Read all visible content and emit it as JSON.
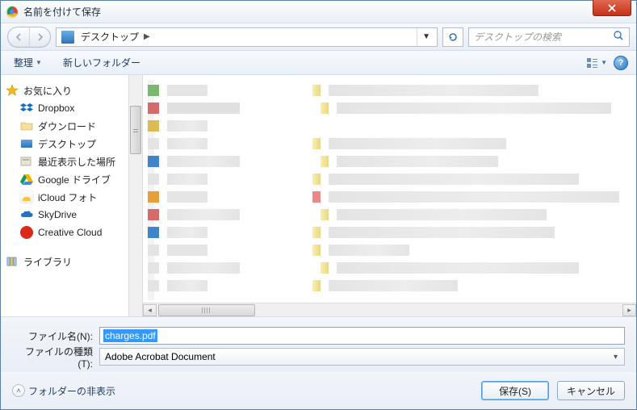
{
  "window": {
    "title": "名前を付けて保存"
  },
  "nav": {
    "location": "デスクトップ",
    "search_placeholder": "デスクトップの検索"
  },
  "toolbar": {
    "organize": "整理",
    "new_folder": "新しいフォルダー"
  },
  "sidebar": {
    "favorites_label": "お気に入り",
    "items": [
      {
        "label": "Dropbox"
      },
      {
        "label": "ダウンロード"
      },
      {
        "label": "デスクトップ"
      },
      {
        "label": "最近表示した場所"
      },
      {
        "label": "Google ドライブ"
      },
      {
        "label": "iCloud フォト"
      },
      {
        "label": "SkyDrive"
      },
      {
        "label": "Creative Cloud"
      }
    ],
    "libraries_label": "ライブラリ"
  },
  "form": {
    "filename_label": "ファイル名(N):",
    "filename_value": "charges.pdf",
    "filetype_label": "ファイルの種類(T):",
    "filetype_value": "Adobe Acrobat Document"
  },
  "footer": {
    "hide_folders": "フォルダーの非表示",
    "save": "保存(S)",
    "cancel": "キャンセル"
  }
}
